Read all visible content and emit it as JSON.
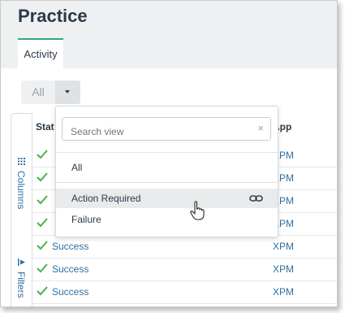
{
  "page": {
    "title": "Practice"
  },
  "tabs": [
    {
      "label": "Activity"
    }
  ],
  "view_toggle": {
    "label": "All"
  },
  "side_panel": {
    "columns_label": "Columns",
    "filters_label": "Filters"
  },
  "table": {
    "headers": {
      "status": "Stat",
      "app": "App"
    },
    "rows": [
      {
        "status": "",
        "app": "XPM"
      },
      {
        "status": "",
        "app": "XPM"
      },
      {
        "status": "",
        "app": "XPM"
      },
      {
        "status": "",
        "app": "XPM"
      },
      {
        "status": "Success",
        "app": "XPM"
      },
      {
        "status": "Success",
        "app": "XPM"
      },
      {
        "status": "Success",
        "app": "XPM"
      }
    ]
  },
  "view_menu": {
    "search_placeholder": "Search view",
    "clear_symbol": "×",
    "options": [
      "All",
      "Action Required",
      "Failure"
    ]
  },
  "colors": {
    "accent": "#3aa67d",
    "link": "#2f6f9f",
    "text": "#2b3a4a",
    "check": "#4caf50",
    "hover_bg": "#e8eaec"
  }
}
